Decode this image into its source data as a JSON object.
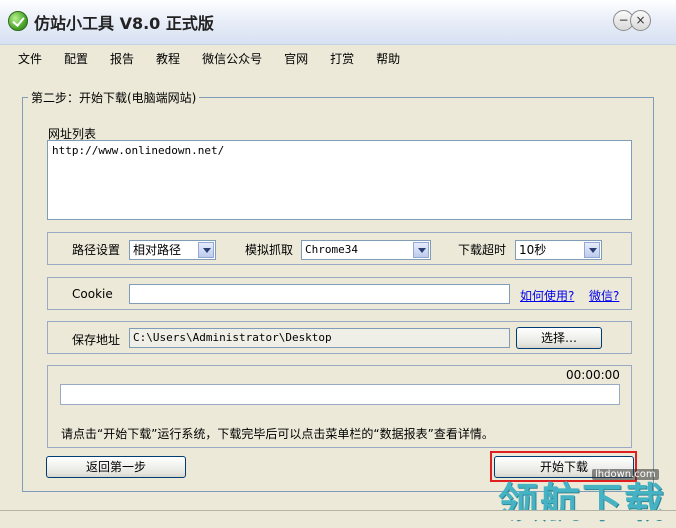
{
  "window": {
    "title": "仿站小工具 V8.0 正式版",
    "minimize": "−",
    "close": "×"
  },
  "menu": [
    "文件",
    "配置",
    "报告",
    "教程",
    "微信公众号",
    "官网",
    "打赏",
    "帮助"
  ],
  "step": {
    "legend": "第二步：开始下载(电脑端网站)",
    "url_list_label": "网址列表",
    "url_list_value": "http://www.onlinedown.net/",
    "path_setting_label": "路径设置",
    "path_setting_value": "相对路径",
    "simulate_label": "模拟抓取",
    "simulate_value": "Chrome34",
    "timeout_label": "下载超时",
    "timeout_value": "10秒",
    "cookie_label": "Cookie",
    "cookie_value": "",
    "how_to_use_link": "如何使用?",
    "wechat_link": "微信?",
    "save_path_label": "保存地址",
    "save_path_value": "C:\\Users\\Administrator\\Desktop",
    "choose_button": "选择…",
    "elapsed_time": "00:00:00",
    "progress": 0,
    "hint": "请点击“开始下载”运行系统，下载完毕后可以点击菜单栏的“数据报表”查看详情。"
  },
  "buttons": {
    "back": "返回第一步",
    "start": "开始下载"
  },
  "watermark": {
    "site": "lhdown.com",
    "big": "领航下载"
  },
  "colors": {
    "highlight": "#e02020",
    "watermark": "#46b3c4"
  }
}
